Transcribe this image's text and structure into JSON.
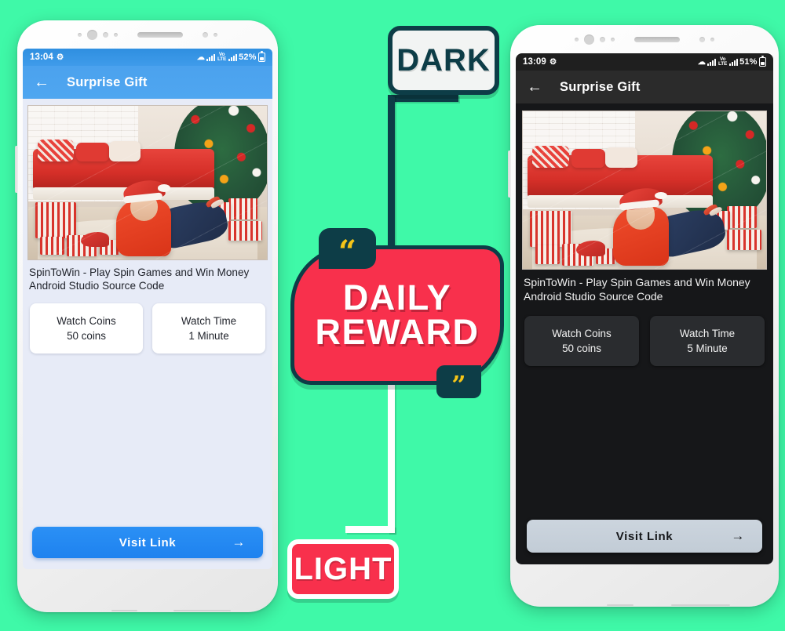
{
  "background_color": "#3ff9a8",
  "labels": {
    "dark": "DARK",
    "light": "LIGHT"
  },
  "badge": {
    "line1": "DAILY",
    "line2": "REWARD",
    "quote_open": "“",
    "quote_close": "”",
    "fill_color": "#f8304c",
    "outline_color": "#0d3d47",
    "quote_color": "#f5c518"
  },
  "light_phone": {
    "theme": "light",
    "status_bar": {
      "time": "13:04",
      "globe_icon": "globe-icon",
      "wifi_icon": "wifi-icon",
      "signal_icon": "signal-bars-icon",
      "hd_label": "Vo\nLTE",
      "battery_percent": "52%",
      "battery_icon": "battery-icon"
    },
    "app_bar": {
      "back_icon": "←",
      "title": "Surprise Gift",
      "color": "#4ba2ee"
    },
    "hero_image_alt": "christmas-promo-image",
    "description": "SpinToWin - Play Spin Games and Win Money Android Studio Source Code",
    "cards": [
      {
        "label": "Watch Coins",
        "value": "50 coins"
      },
      {
        "label": "Watch Time",
        "value": "1 Minute"
      }
    ],
    "visit_button": {
      "label": "Visit Link",
      "arrow": "→",
      "color": "#2b90f5"
    }
  },
  "dark_phone": {
    "theme": "dark",
    "status_bar": {
      "time": "13:09",
      "globe_icon": "globe-icon",
      "wifi_icon": "wifi-icon",
      "signal_icon": "signal-bars-icon",
      "hd_label": "Vo\nLTE",
      "battery_percent": "51%",
      "battery_icon": "battery-icon"
    },
    "app_bar": {
      "back_icon": "←",
      "title": "Surprise Gift",
      "color": "#2b2b2b"
    },
    "hero_image_alt": "christmas-promo-image",
    "description": "SpinToWin - Play Spin Games and Win Money Android Studio Source Code",
    "cards": [
      {
        "label": "Watch Coins",
        "value": "50 coins"
      },
      {
        "label": "Watch Time",
        "value": "5 Minute"
      }
    ],
    "visit_button": {
      "label": "Visit Link",
      "arrow": "→",
      "color": "#c7d1da"
    }
  }
}
